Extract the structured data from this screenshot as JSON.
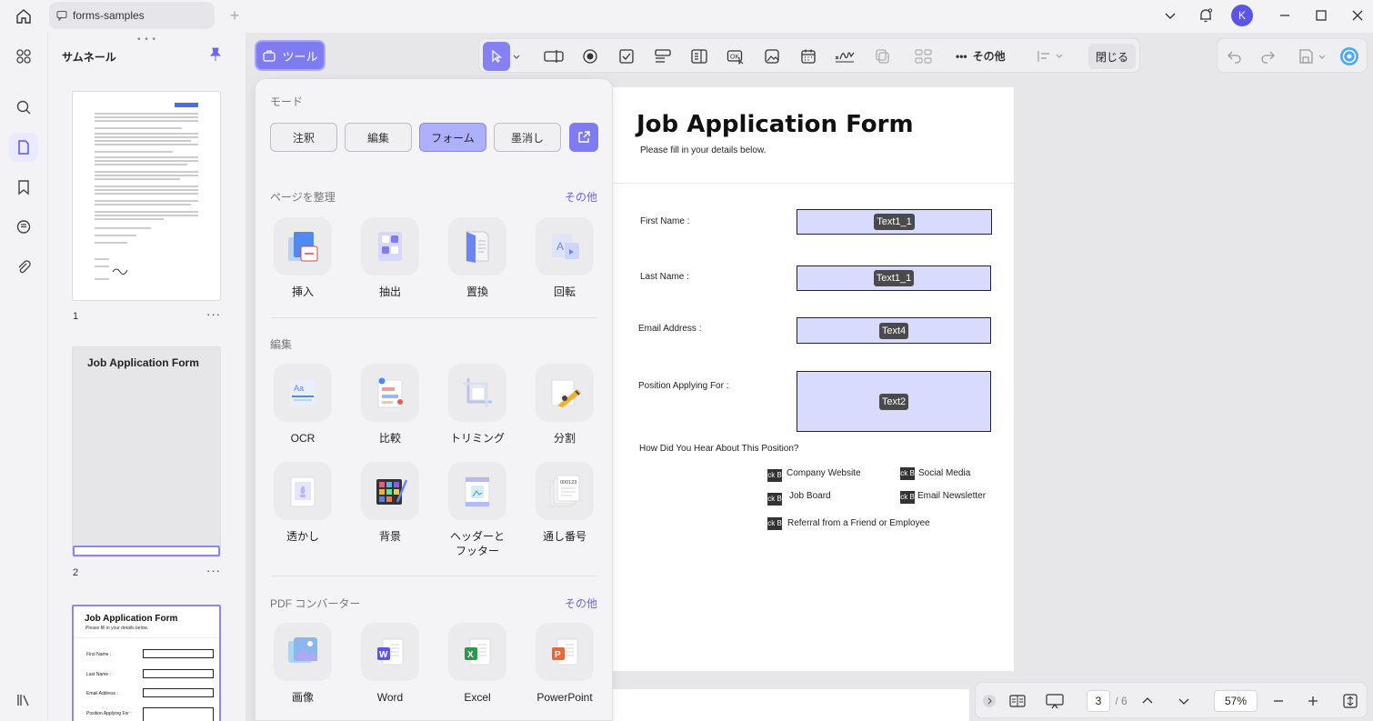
{
  "window": {
    "tab_title": "forms-samples",
    "avatar_initial": "K"
  },
  "thumbnails": {
    "title": "サムネール",
    "pages": [
      {
        "number": "1"
      },
      {
        "number": "2",
        "title": "Job Application Form"
      },
      {
        "number": "3",
        "title": "Job Application Form",
        "subtitle": "Please fill in your details below.",
        "labels": [
          "First Name :",
          "Last Name :",
          "Email Address :",
          "Position Applying For :"
        ]
      }
    ]
  },
  "toolbar": {
    "tool_label": "ツール",
    "more_label": "その他",
    "close_label": "閉じる"
  },
  "panel": {
    "mode_title": "モード",
    "modes": [
      "注釈",
      "編集",
      "フォーム",
      "墨消し"
    ],
    "organize_title": "ページを整理",
    "organize_more": "その他",
    "organize_items": [
      "挿入",
      "抽出",
      "置換",
      "回転"
    ],
    "edit_title": "編集",
    "edit_items": [
      "OCR",
      "比較",
      "トリミング",
      "分割",
      "透かし",
      "背景",
      "ヘッダーと\nフッター",
      "通し番号"
    ],
    "convert_title": "PDF コンバーター",
    "convert_more": "その他",
    "convert_items": [
      "画像",
      "Word",
      "Excel",
      "PowerPoint"
    ]
  },
  "document": {
    "title": "Job Application Form",
    "subtitle": "Please fill in your details below.",
    "fields": [
      {
        "label": "First Name :",
        "tag": "Text1_1"
      },
      {
        "label": "Last Name :",
        "tag": "Text1_1"
      },
      {
        "label": "Email Address :",
        "tag": "Text4"
      },
      {
        "label": "Position Applying For :",
        "tag": "Text2"
      }
    ],
    "question": "How Did You Hear About This Position?",
    "checkbox_tag": "ck B",
    "options": [
      "Company Website",
      "Social Media",
      "Job Board",
      "Email Newsletter",
      "Referral from a Friend or Employee"
    ]
  },
  "pagination": {
    "current": "3",
    "total": "/ 6",
    "zoom": "57%"
  },
  "colors": {
    "accent": "#7e7cf0",
    "field_fill": "#d8dafe",
    "active_mode": "#aeb0fb"
  }
}
